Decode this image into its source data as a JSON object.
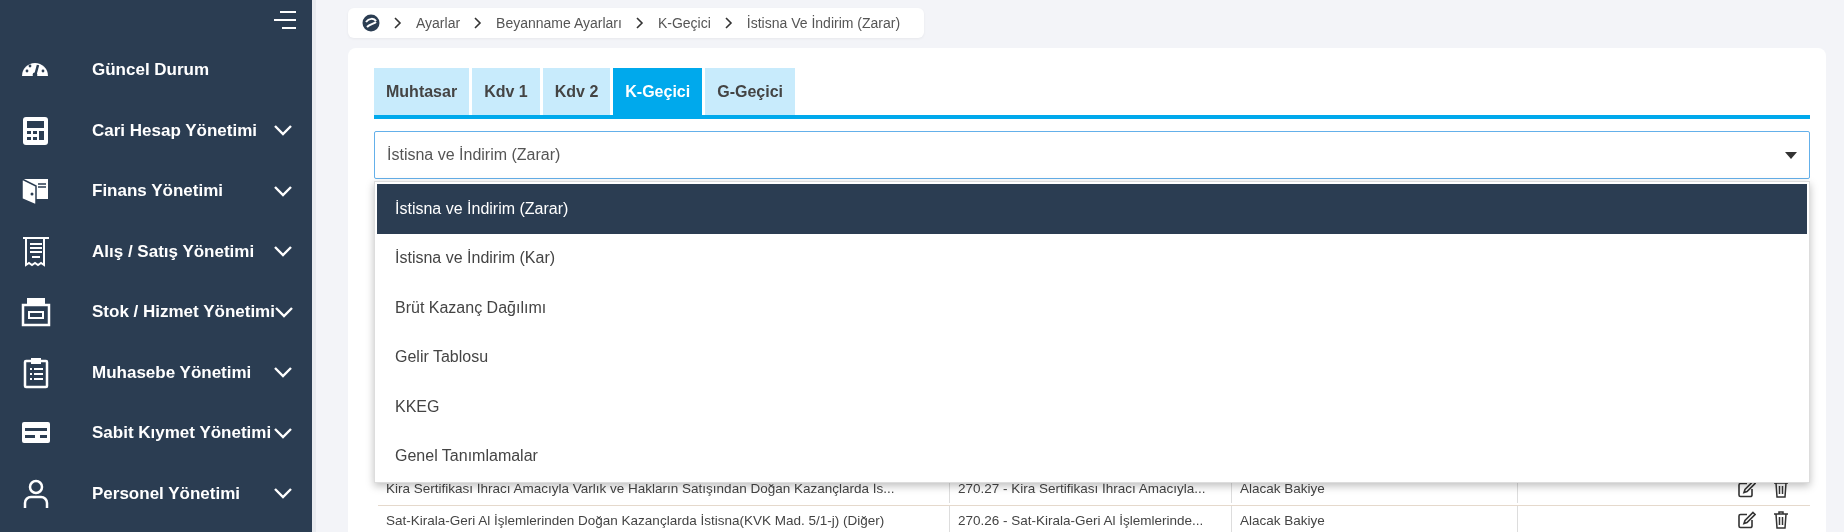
{
  "sidebar": {
    "items": [
      {
        "label": "Güncel Durum",
        "has_submenu": false
      },
      {
        "label": "Cari Hesap Yönetimi",
        "has_submenu": true
      },
      {
        "label": "Finans Yönetimi",
        "has_submenu": true
      },
      {
        "label": "Alış / Satış Yönetimi",
        "has_submenu": true
      },
      {
        "label": "Stok / Hizmet Yönetimi",
        "has_submenu": true
      },
      {
        "label": "Muhasebe Yönetimi",
        "has_submenu": true
      },
      {
        "label": "Sabit Kıymet Yönetimi",
        "has_submenu": true
      },
      {
        "label": "Personel Yönetimi",
        "has_submenu": true
      }
    ]
  },
  "breadcrumb": [
    "Ayarlar",
    "Beyanname Ayarları",
    "K-Geçici",
    "İstisna Ve İndirim (Zarar)"
  ],
  "tabs": [
    {
      "label": "Muhtasar",
      "selected": false
    },
    {
      "label": "Kdv 1",
      "selected": false
    },
    {
      "label": "Kdv 2",
      "selected": false
    },
    {
      "label": "K-Geçici",
      "selected": true
    },
    {
      "label": "G-Geçici",
      "selected": false
    }
  ],
  "select": {
    "value": "İstisna ve İndirim (Zarar)",
    "expanded": true,
    "options": [
      {
        "label": "İstisna ve İndirim (Zarar)",
        "selected": true
      },
      {
        "label": "İstisna ve İndirim (Kar)",
        "selected": false
      },
      {
        "label": "Brüt Kazanç Dağılımı",
        "selected": false
      },
      {
        "label": "Gelir Tablosu",
        "selected": false
      },
      {
        "label": "KKEG",
        "selected": false
      },
      {
        "label": "Genel Tanımlamalar",
        "selected": false
      }
    ]
  },
  "table": {
    "rows": [
      {
        "cells": [
          "Kira Sertifikası İhracı Amacıyla Varlık ve Hakların Satışından Doğan Kazançlarda İs...",
          "270.27 - Kira Sertifikası İhracı Amacıyla...",
          "Alacak Bakiye"
        ]
      },
      {
        "cells": [
          "Sat-Kirala-Geri Al İşlemlerinden Doğan Kazançlarda İstisna(KVK Mad. 5/1-j) (Diğer)",
          "270.26 - Sat-Kirala-Geri Al İşlemlerinde...",
          "Alacak Bakiye"
        ]
      }
    ]
  }
}
